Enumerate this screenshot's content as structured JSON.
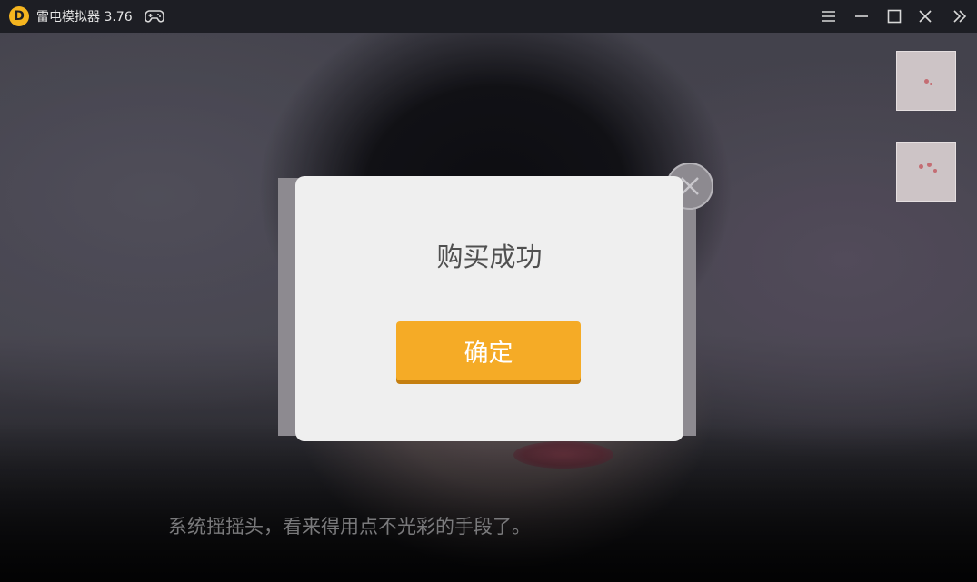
{
  "window": {
    "logo_glyph": "D",
    "title": "雷电模拟器 3.76",
    "controls": [
      "menu-icon",
      "minimize-icon",
      "maximize-icon",
      "close-icon",
      "double-chevron-icon"
    ]
  },
  "dialog": {
    "title": "购买成功",
    "confirm_label": "确定"
  },
  "subtitle": "系统摇摇头，看来得用点不光彩的手段了。",
  "colors": {
    "titlebar": "#1d1e24",
    "logo": "#f5b51f",
    "dialog_bg": "#efefef",
    "button": "#f5ab26",
    "button_text": "#ffffff"
  }
}
